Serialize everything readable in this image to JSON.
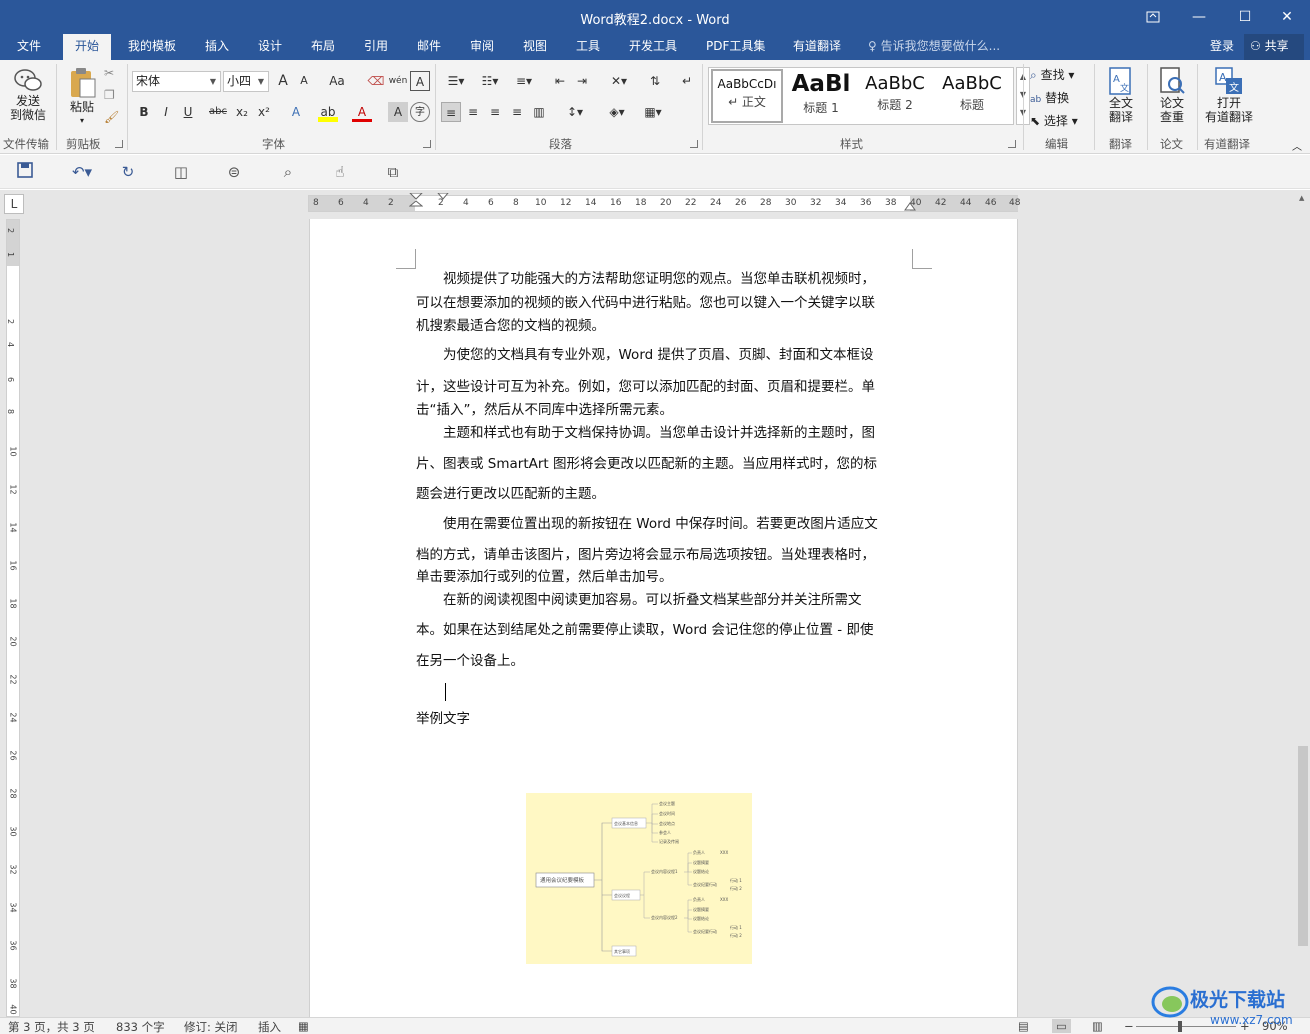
{
  "window": {
    "title": "Word教程2.docx - Word",
    "restore_icon": "ribbon-display-icon",
    "min": "—",
    "max": "☐",
    "close": "✕"
  },
  "tabs": [
    "文件",
    "开始",
    "我的模板",
    "插入",
    "设计",
    "布局",
    "引用",
    "邮件",
    "审阅",
    "视图",
    "工具",
    "开发工具",
    "PDF工具集",
    "有道翻译"
  ],
  "active_tab": "开始",
  "tell_me": "告诉我您想要做什么...",
  "login": "登录",
  "share": "共享",
  "ribbon": {
    "file_transfer": {
      "button": "发送到微信",
      "button_l1": "发送",
      "button_l2": "到微信",
      "label": "文件传输"
    },
    "clipboard": {
      "paste": "粘贴",
      "label": "剪贴板"
    },
    "font": {
      "name": "宋体",
      "size": "小四",
      "label": "字体",
      "bold": "B",
      "italic": "I",
      "underline": "U",
      "strike": "abc",
      "sub": "x₂",
      "sup": "x²",
      "grow": "A",
      "shrink": "A",
      "case": "Aa",
      "phonetic": "wén",
      "border": "A",
      "effects": "A",
      "highlight": "ab",
      "color": "A",
      "shade": "A",
      "enclose": "字"
    },
    "paragraph": {
      "label": "段落"
    },
    "styles": {
      "label": "样式",
      "items": [
        {
          "sample": "AaBbCcDı",
          "name": "↵ 正文"
        },
        {
          "sample": "AaBl",
          "name": "标题 1"
        },
        {
          "sample": "AaBbC",
          "name": "标题 2"
        },
        {
          "sample": "AaBbC",
          "name": "标题"
        }
      ]
    },
    "editing": {
      "label": "编辑",
      "find": "查找",
      "replace": "替换",
      "select": "选择"
    },
    "translate": {
      "label": "翻译",
      "button": "全文翻译",
      "button_l1": "全文",
      "button_l2": "翻译"
    },
    "paper": {
      "label": "论文",
      "button": "论文查重",
      "button_l1": "论文",
      "button_l2": "查重"
    },
    "youdao": {
      "label": "有道翻译",
      "button": "打开有道翻译",
      "button_l1": "打开",
      "button_l2": "有道翻译"
    }
  },
  "ruler": {
    "h_ticks": [
      "8",
      "6",
      "4",
      "2",
      "2",
      "4",
      "6",
      "8",
      "10",
      "12",
      "14",
      "16",
      "18",
      "20",
      "22",
      "24",
      "26",
      "28",
      "30",
      "32",
      "34",
      "36",
      "38",
      "40",
      "42",
      "44",
      "46",
      "48"
    ],
    "corner": "L",
    "v_ticks": [
      "2",
      "1",
      "2",
      "4",
      "6",
      "8",
      "10",
      "12",
      "14",
      "16",
      "18",
      "20",
      "22",
      "24",
      "26",
      "28",
      "30",
      "32",
      "34",
      "36",
      "38",
      "40"
    ]
  },
  "document": {
    "lines": [
      "　　视频提供了功能强大的方法帮助您证明您的观点。当您单击联机视频时，",
      "可以在想要添加的视频的嵌入代码中进行粘贴。您也可以键入一个关键字以联",
      "机搜索最适合您的文档的视频。",
      "　　为使您的文档具有专业外观，Word 提供了页眉、页脚、封面和文本框设",
      "计，这些设计可互为补充。例如，您可以添加匹配的封面、页眉和提要栏。单",
      "击“插入”，然后从不同库中选择所需元素。",
      "　　主题和样式也有助于文档保持协调。当您单击设计并选择新的主题时，图",
      "片、图表或 SmartArt 图形将会更改以匹配新的主题。当应用样式时，您的标",
      "题会进行更改以匹配新的主题。",
      "　　使用在需要位置出现的新按钮在 Word 中保存时间。若要更改图片适应文",
      "档的方式，请单击该图片，图片旁边将会显示布局选项按钮。当处理表格时，",
      "单击要添加行或列的位置，然后单击加号。",
      "　　在新的阅读视图中阅读更加容易。可以折叠文档某些部分并关注所需文",
      "本。如果在达到结尾处之前需要停止读取，Word 会记住您的停止位置 - 即使",
      "在另一个设备上。"
    ],
    "example_text": "举例文字"
  },
  "mindmap": {
    "root": "通用会议纪要模板",
    "branches": [
      "会议基本信息",
      "会议议程",
      "其它事项"
    ],
    "sub_a": [
      "会议主题",
      "会议时间",
      "会议地点",
      "参会人",
      "记录及传阅"
    ],
    "sub_b": [
      "会议内容议程1",
      "会议内容议程2"
    ],
    "leaf": [
      "负责人",
      "议题摘要",
      "议题结论",
      "会议纪要行动",
      "XXX",
      "行动 1",
      "行动 2"
    ]
  },
  "status": {
    "page": "第 3 页，共 3 页",
    "words": "833 个字",
    "track": "修订: 关闭",
    "mode": "插入",
    "zoom": "90%"
  },
  "watermark": {
    "brand": "极光下载站",
    "url": "www.xz7.com"
  }
}
